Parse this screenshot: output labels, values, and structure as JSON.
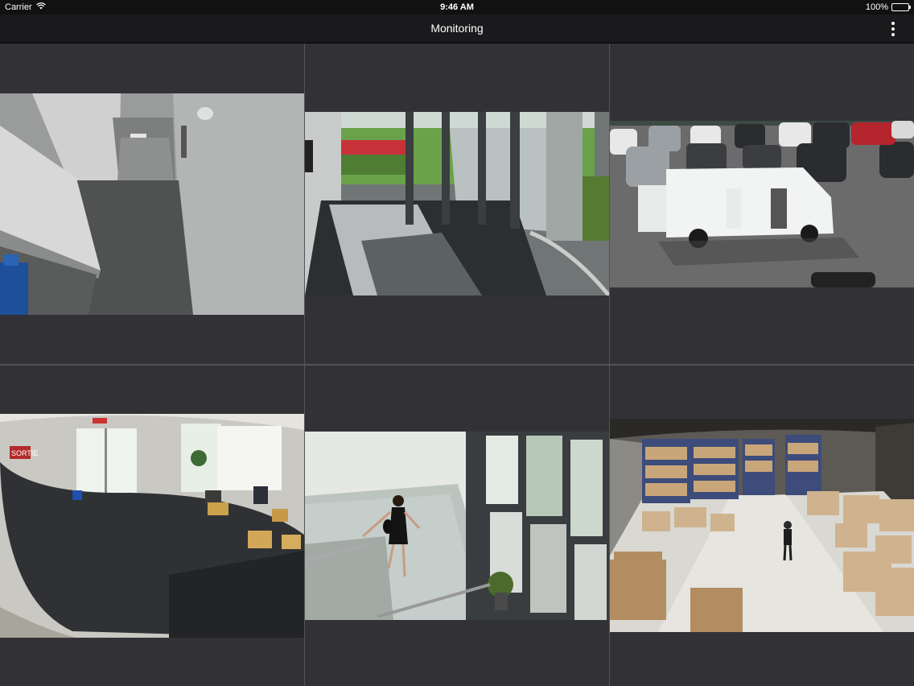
{
  "status_bar": {
    "carrier": "Carrier",
    "time": "9:46 AM",
    "battery_text": "100%",
    "battery_level": 1.0
  },
  "nav": {
    "title": "Monitoring",
    "menu_icon": "more-vertical-icon"
  },
  "cameras": [
    {
      "id": 1,
      "scene": "hallway"
    },
    {
      "id": 2,
      "scene": "glass-entrance"
    },
    {
      "id": 3,
      "scene": "parking-lot"
    },
    {
      "id": 4,
      "scene": "lobby-fisheye"
    },
    {
      "id": 5,
      "scene": "stairwell"
    },
    {
      "id": 6,
      "scene": "warehouse"
    }
  ],
  "signage": {
    "exit_sign": "SORTIE"
  }
}
